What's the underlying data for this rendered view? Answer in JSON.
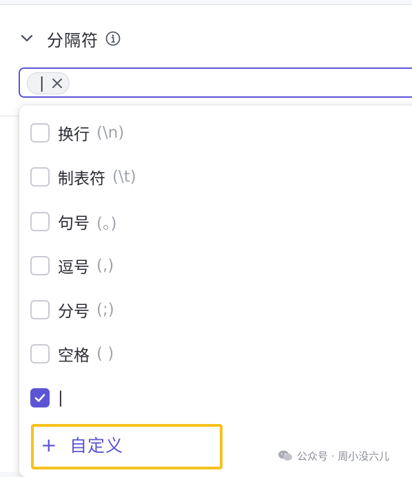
{
  "section": {
    "title": "分隔符",
    "selected_tag": "|"
  },
  "options": [
    {
      "label": "换行",
      "hint": "(\\n)",
      "checked": false
    },
    {
      "label": "制表符",
      "hint": "(\\t)",
      "checked": false
    },
    {
      "label": "句号",
      "hint": "(。)",
      "checked": false
    },
    {
      "label": "逗号",
      "hint": "(,)",
      "checked": false
    },
    {
      "label": "分号",
      "hint": "(;)",
      "checked": false
    },
    {
      "label": "空格",
      "hint": "( )",
      "checked": false
    },
    {
      "label": "|",
      "hint": "",
      "checked": true
    }
  ],
  "custom": {
    "plus": "+",
    "label": "自定义"
  },
  "watermark": {
    "text": "公众号 · 周小没六儿"
  },
  "colors": {
    "accent": "#5b55d6",
    "highlight": "#f7c11d"
  }
}
